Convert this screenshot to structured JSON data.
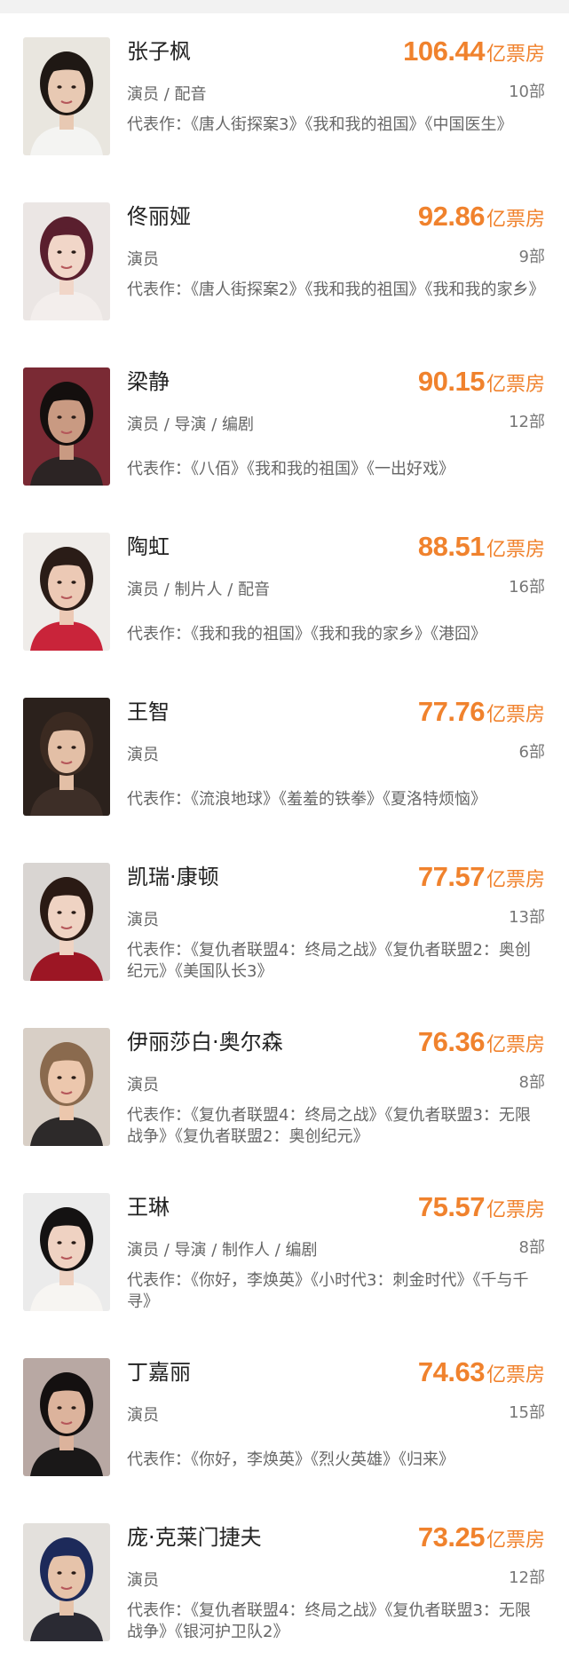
{
  "actors": [
    {
      "name": "张子枫",
      "box_office": "106.44",
      "unit": "亿票房",
      "roles": "演员 / 配音",
      "count": "10部",
      "works": "代表作：《唐人街探案3》《我和我的祖国》《中国医生》",
      "avatar_icon": "portrait-photo",
      "colors": {
        "bg": "#e9e6df",
        "hair": "#1f1814",
        "skin": "#e8c9b3",
        "cloth": "#f4f4f2"
      }
    },
    {
      "name": "佟丽娅",
      "box_office": "92.86",
      "unit": "亿票房",
      "roles": "演员",
      "count": "9部",
      "works": "代表作：《唐人街探案2》《我和我的祖国》《我和我的家乡》",
      "avatar_icon": "portrait-photo",
      "colors": {
        "bg": "#ebe6e4",
        "hair": "#5a1f2e",
        "skin": "#f1d6c8",
        "cloth": "#f3eeec"
      }
    },
    {
      "name": "梁静",
      "box_office": "90.15",
      "unit": "亿票房",
      "roles": "演员 / 导演 / 编剧",
      "count": "12部",
      "works": "代表作：《八佰》《我和我的祖国》《一出好戏》",
      "avatar_icon": "portrait-photo",
      "colors": {
        "bg": "#7a2a34",
        "hair": "#140f0e",
        "skin": "#c99a82",
        "cloth": "#2c2424"
      }
    },
    {
      "name": "陶虹",
      "box_office": "88.51",
      "unit": "亿票房",
      "roles": "演员 / 制片人 / 配音",
      "count": "16部",
      "works": "代表作：《我和我的祖国》《我和我的家乡》《港囧》",
      "avatar_icon": "portrait-photo",
      "colors": {
        "bg": "#efece9",
        "hair": "#2a1c17",
        "skin": "#ecc9b5",
        "cloth": "#c9243a"
      }
    },
    {
      "name": "王智",
      "box_office": "77.76",
      "unit": "亿票房",
      "roles": "演员",
      "count": "6部",
      "works": "代表作：《流浪地球》《羞羞的铁拳》《夏洛特烦恼》",
      "avatar_icon": "portrait-photo",
      "colors": {
        "bg": "#2b211c",
        "hair": "#3b2a21",
        "skin": "#e3bfa6",
        "cloth": "#3d2e27"
      }
    },
    {
      "name": "凯瑞·康顿",
      "box_office": "77.57",
      "unit": "亿票房",
      "roles": "演员",
      "count": "13部",
      "works": "代表作：《复仇者联盟4：终局之战》《复仇者联盟2：奥创纪元》《美国队长3》",
      "avatar_icon": "portrait-photo",
      "colors": {
        "bg": "#d9d5d2",
        "hair": "#2a1a14",
        "skin": "#efd3c3",
        "cloth": "#9c1624"
      }
    },
    {
      "name": "伊丽莎白·奥尔森",
      "box_office": "76.36",
      "unit": "亿票房",
      "roles": "演员",
      "count": "8部",
      "works": "代表作：《复仇者联盟4：终局之战》《复仇者联盟3：无限战争》《复仇者联盟2：奥创纪元》",
      "avatar_icon": "portrait-photo",
      "colors": {
        "bg": "#d8cfc6",
        "hair": "#8a6a4e",
        "skin": "#ecc7ad",
        "cloth": "#2d2a2a"
      }
    },
    {
      "name": "王琳",
      "box_office": "75.57",
      "unit": "亿票房",
      "roles": "演员 / 导演 / 制作人 / 编剧",
      "count": "8部",
      "works": "代表作：《你好，李焕英》《小时代3：刺金时代》《千与千寻》",
      "avatar_icon": "portrait-photo",
      "colors": {
        "bg": "#ebebeb",
        "hair": "#141212",
        "skin": "#efd2c2",
        "cloth": "#f7f5f2"
      }
    },
    {
      "name": "丁嘉丽",
      "box_office": "74.63",
      "unit": "亿票房",
      "roles": "演员",
      "count": "15部",
      "works": "代表作：《你好，李焕英》《烈火英雄》《归来》",
      "avatar_icon": "portrait-photo",
      "colors": {
        "bg": "#b8a8a3",
        "hair": "#141010",
        "skin": "#dcb39c",
        "cloth": "#1a1818"
      }
    },
    {
      "name": "庞·克莱门捷夫",
      "box_office": "73.25",
      "unit": "亿票房",
      "roles": "演员",
      "count": "12部",
      "works": "代表作：《复仇者联盟4：终局之战》《复仇者联盟3：无限战争》《银河护卫队2》",
      "avatar_icon": "portrait-photo",
      "colors": {
        "bg": "#e3e0dc",
        "hair": "#1d2a5a",
        "skin": "#e6c3aa",
        "cloth": "#2a2a33"
      }
    }
  ]
}
